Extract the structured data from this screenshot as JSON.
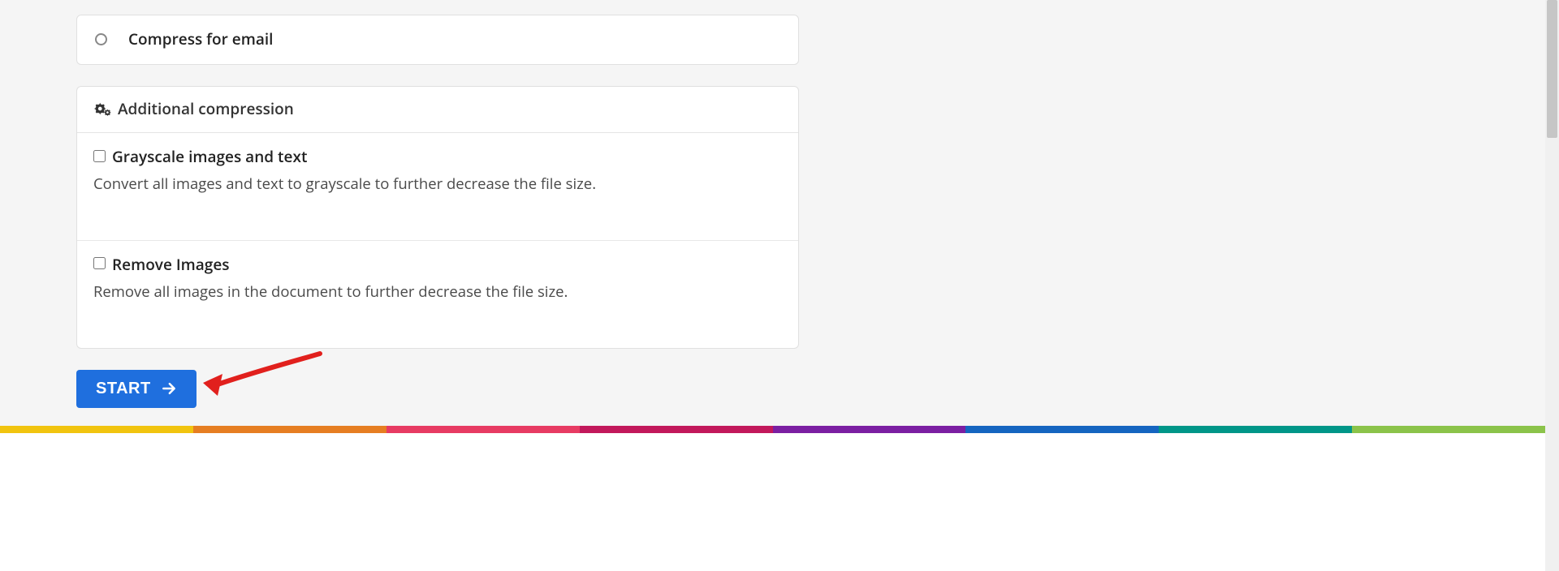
{
  "radio_option": {
    "label": "Compress for email",
    "selected": false
  },
  "additional": {
    "title": "Additional compression",
    "options": [
      {
        "key": "grayscale",
        "title": "Grayscale images and text",
        "desc": "Convert all images and text to grayscale to further decrease the file size.",
        "checked": false
      },
      {
        "key": "remove-images",
        "title": "Remove Images",
        "desc": "Remove all images in the document to further decrease the file size.",
        "checked": false
      }
    ]
  },
  "action": {
    "start_label": "START"
  },
  "footer_colors": [
    "#f1c40f",
    "#e67e22",
    "#e73b63",
    "#c2185b",
    "#7b1fa2",
    "#1565c0",
    "#009688",
    "#8bc34a"
  ],
  "annotation_arrow_color": "#e1201d"
}
